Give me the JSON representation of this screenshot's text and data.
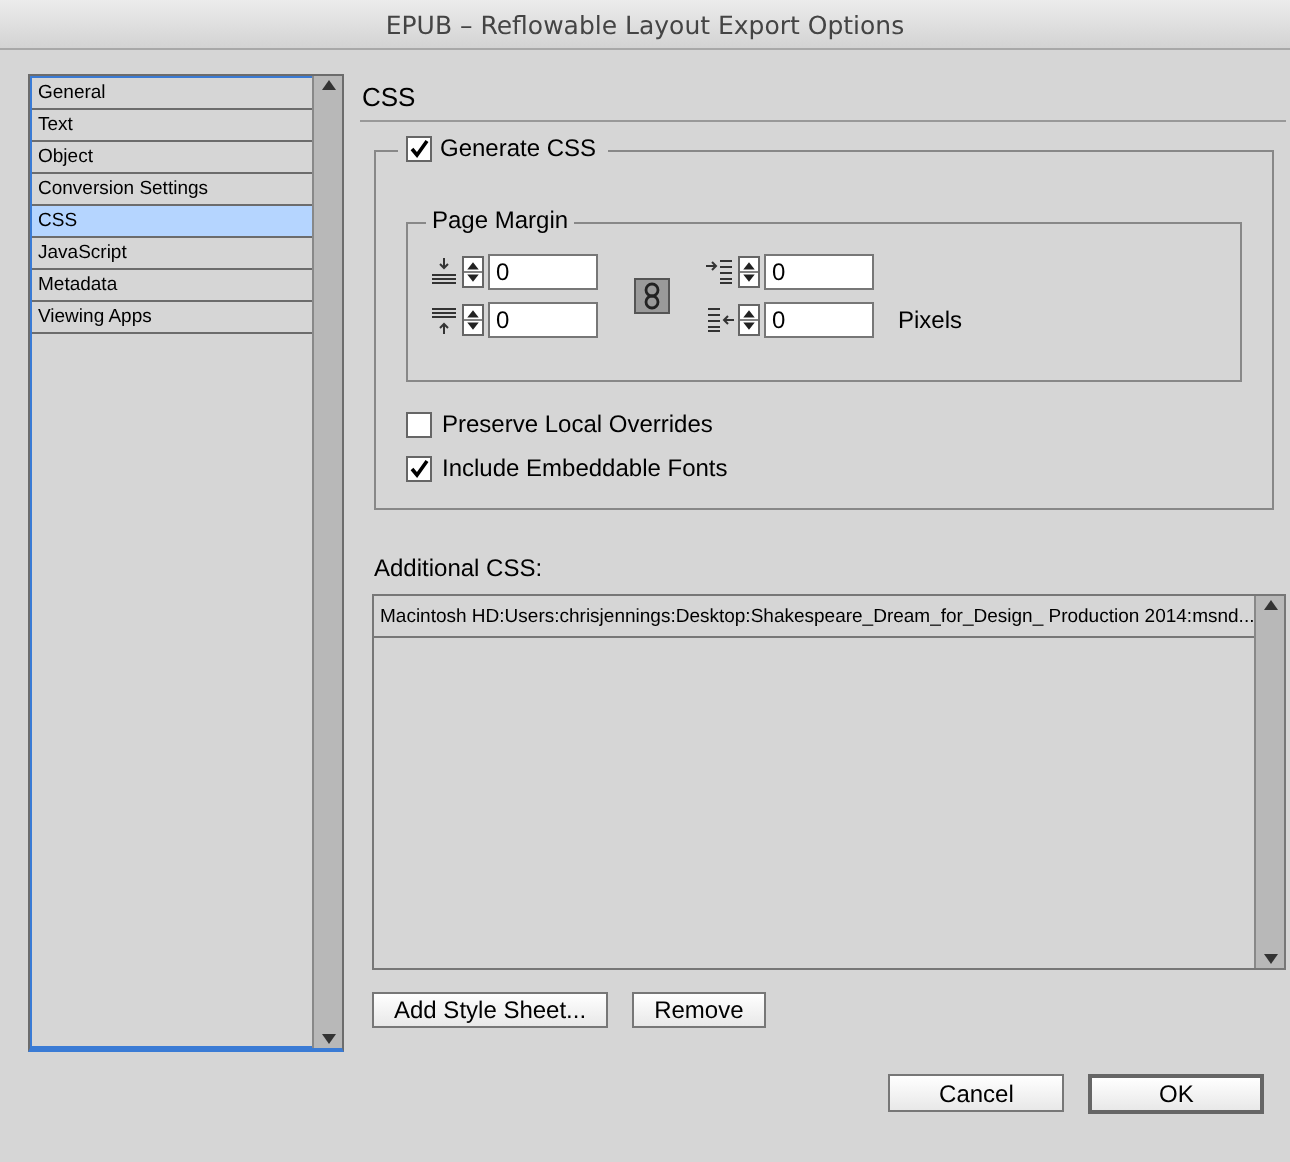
{
  "window": {
    "title": "EPUB – Reflowable Layout Export Options"
  },
  "sidebar": {
    "items": [
      {
        "label": "General",
        "selected": false
      },
      {
        "label": "Text",
        "selected": false
      },
      {
        "label": "Object",
        "selected": false
      },
      {
        "label": "Conversion Settings",
        "selected": false
      },
      {
        "label": "CSS",
        "selected": true
      },
      {
        "label": "JavaScript",
        "selected": false
      },
      {
        "label": "Metadata",
        "selected": false
      },
      {
        "label": "Viewing Apps",
        "selected": false
      }
    ]
  },
  "section_title": "CSS",
  "generate_css": {
    "label": "Generate CSS",
    "checked": true
  },
  "page_margin": {
    "title": "Page Margin",
    "fields": [
      {
        "kind": "top",
        "value": "0"
      },
      {
        "kind": "left",
        "value": "0"
      },
      {
        "kind": "bottom",
        "value": "0"
      },
      {
        "kind": "right",
        "value": "0"
      }
    ],
    "unit": "Pixels"
  },
  "options": [
    {
      "label": "Preserve Local Overrides",
      "checked": false
    },
    {
      "label": "Include Embeddable Fonts",
      "checked": true
    }
  ],
  "additional_css": {
    "label": "Additional CSS:",
    "items": [
      "Macintosh HD:Users:chrisjennings:Desktop:Shakespeare_Dream_for_Design_ Production 2014:msnd..."
    ]
  },
  "list_buttons": [
    "Add Style Sheet...",
    "Remove"
  ],
  "buttons": [
    {
      "label": "Cancel",
      "kind": "normal"
    },
    {
      "label": "OK",
      "kind": "default"
    }
  ]
}
